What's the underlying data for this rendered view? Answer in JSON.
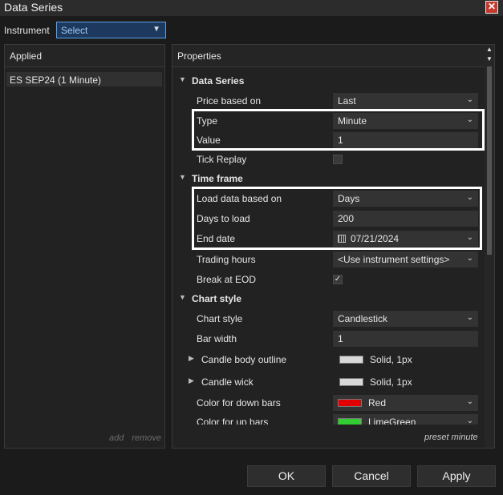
{
  "window": {
    "title": "Data Series",
    "close_glyph": "✕"
  },
  "instrument": {
    "label": "Instrument",
    "value": "Select"
  },
  "applied": {
    "header": "Applied",
    "items": [
      "ES SEP24 (1 Minute)"
    ],
    "add_label": "add",
    "remove_label": "remove"
  },
  "properties": {
    "header": "Properties",
    "preset_label": "preset minute",
    "rows": {
      "data_series": "Data Series",
      "price_based_on": {
        "label": "Price based on",
        "value": "Last"
      },
      "type": {
        "label": "Type",
        "value": "Minute"
      },
      "value": {
        "label": "Value",
        "value": "1"
      },
      "tick_replay": {
        "label": "Tick Replay",
        "checked": false
      },
      "time_frame": "Time frame",
      "load_data_based_on": {
        "label": "Load data based on",
        "value": "Days"
      },
      "days_to_load": {
        "label": "Days to load",
        "value": "200"
      },
      "end_date": {
        "label": "End date",
        "value": "07/21/2024"
      },
      "trading_hours": {
        "label": "Trading hours",
        "value": "<Use instrument settings>"
      },
      "break_at_eod": {
        "label": "Break at EOD",
        "checked": true,
        "check_glyph": "✓"
      },
      "chart_style_cat": "Chart style",
      "chart_style": {
        "label": "Chart style",
        "value": "Candlestick"
      },
      "bar_width": {
        "label": "Bar width",
        "value": "1"
      },
      "candle_body_outline": {
        "label": "Candle body outline",
        "value": "Solid, 1px",
        "color": "#d8d8d8"
      },
      "candle_wick": {
        "label": "Candle wick",
        "value": "Solid, 1px",
        "color": "#d8d8d8"
      },
      "color_down_bars": {
        "label": "Color for down bars",
        "value": "Red",
        "color": "#e00000"
      },
      "color_up_bars": {
        "label": "Color for up bars",
        "value": "LimeGreen",
        "color": "#32cd32"
      }
    }
  },
  "buttons": {
    "ok": "OK",
    "cancel": "Cancel",
    "apply": "Apply"
  },
  "icons": {
    "expand_down": "▾",
    "expand_right": "▸",
    "chevron": "⌄",
    "calendar": "calendar-icon"
  }
}
